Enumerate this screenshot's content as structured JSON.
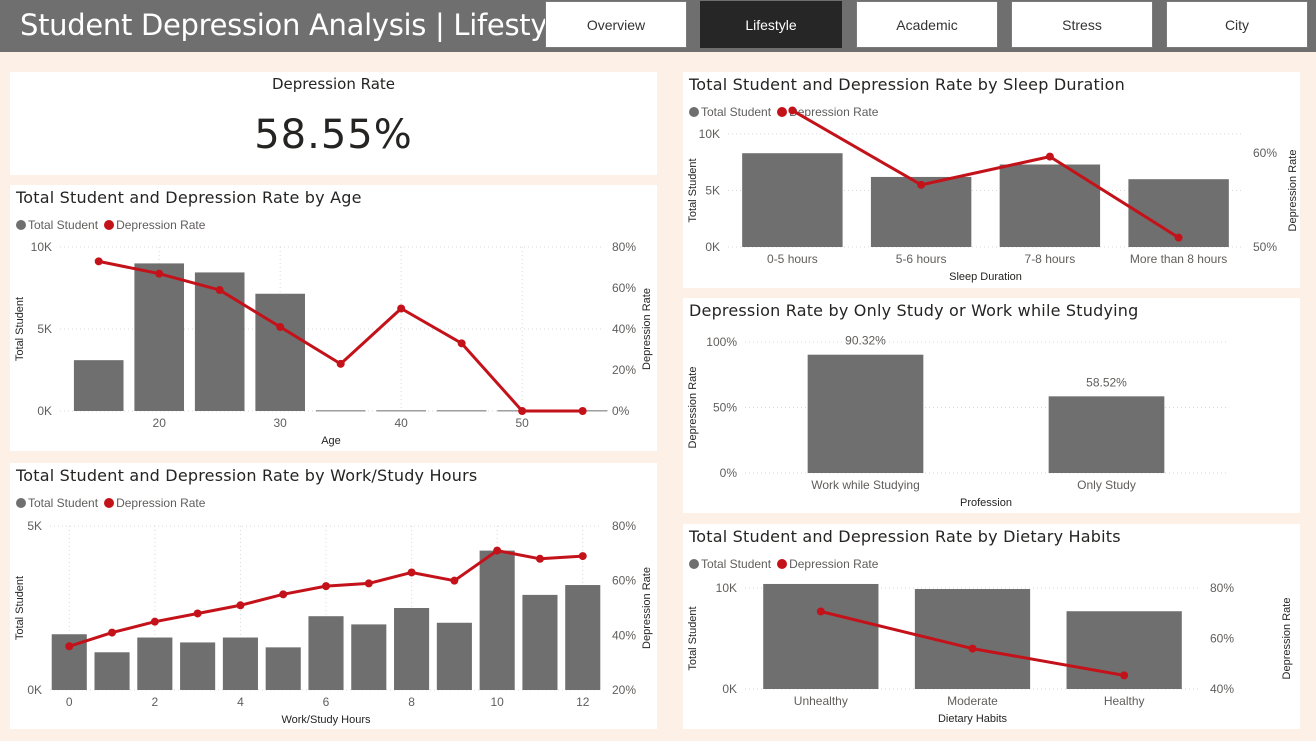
{
  "header": {
    "title": "Student Depression Analysis | Lifestyle",
    "tabs": [
      {
        "label": "Overview",
        "active": false
      },
      {
        "label": "Lifestyle",
        "active": true
      },
      {
        "label": "Academic",
        "active": false
      },
      {
        "label": "Stress",
        "active": false
      },
      {
        "label": "City",
        "active": false
      }
    ]
  },
  "colors": {
    "bar": "#6f6f6f",
    "line": "#c4121a",
    "grid": "#d9d9d9",
    "background": "#fdf0e6"
  },
  "kpi": {
    "title": "Depression Rate",
    "value": "58.55%"
  },
  "legend": {
    "total_student": "Total Student",
    "depression_rate": "Depression Rate"
  },
  "charts": {
    "age": {
      "title": "Total Student and Depression Rate by Age",
      "chart_data": {
        "type": "bar",
        "combo": "bar+line",
        "xlabel": "Age",
        "ylabel": "Total Student",
        "y2label": "Depression Rate",
        "x_ticks": [
          "20",
          "30",
          "40",
          "50"
        ],
        "x": [
          15,
          20,
          25,
          30,
          35,
          40,
          45,
          50,
          55
        ],
        "series": [
          {
            "name": "Total Student",
            "type": "bar",
            "values": [
              3100,
              9000,
              8450,
              7150,
              40,
              40,
              40,
              40,
              40
            ]
          },
          {
            "name": "Depression Rate",
            "type": "line",
            "axis": "right",
            "values": [
              73,
              67,
              59,
              41,
              23,
              50,
              33,
              0,
              0
            ]
          }
        ],
        "ylim": [
          0,
          10000
        ],
        "y_ticks": [
          "0K",
          "5K",
          "10K"
        ],
        "y2lim": [
          0,
          80
        ],
        "y2_ticks": [
          "0%",
          "20%",
          "40%",
          "60%",
          "80%"
        ]
      }
    },
    "sleep": {
      "title": "Total Student and Depression Rate by Sleep Duration",
      "chart_data": {
        "type": "bar",
        "combo": "bar+line",
        "xlabel": "Sleep Duration",
        "ylabel": "Total Student",
        "y2label": "Depression Rate",
        "categories": [
          "0-5 hours",
          "5-6 hours",
          "7-8 hours",
          "More than 8 hours"
        ],
        "series": [
          {
            "name": "Total Student",
            "type": "bar",
            "values": [
              8300,
              6200,
              7300,
              6000
            ]
          },
          {
            "name": "Depression Rate",
            "type": "line",
            "axis": "right",
            "values": [
              64.5,
              56.6,
              59.6,
              51.0
            ]
          }
        ],
        "ylim": [
          0,
          10000
        ],
        "y_ticks": [
          "0K",
          "5K",
          "10K"
        ],
        "y2lim": [
          50,
          62
        ],
        "y2_ticks": [
          "50%",
          "60%"
        ]
      }
    },
    "profession": {
      "title": "Depression Rate by Only Study or Work while Studying",
      "chart_data": {
        "type": "bar",
        "xlabel": "Profession",
        "ylabel": "Depression Rate",
        "categories": [
          "Work while Studying",
          "Only Study"
        ],
        "values": [
          90.32,
          58.52
        ],
        "data_labels": [
          "90.32%",
          "58.52%"
        ],
        "ylim": [
          0,
          100
        ],
        "y_ticks": [
          "0%",
          "50%",
          "100%"
        ]
      }
    },
    "hours": {
      "title": "Total Student and Depression Rate by Work/Study Hours",
      "chart_data": {
        "type": "bar",
        "combo": "bar+line",
        "xlabel": "Work/Study Hours",
        "ylabel": "Total Student",
        "y2label": "Depression Rate",
        "x_ticks": [
          "0",
          "2",
          "4",
          "6",
          "8",
          "10",
          "12"
        ],
        "x": [
          0,
          1,
          2,
          3,
          4,
          5,
          6,
          7,
          8,
          9,
          10,
          11,
          12
        ],
        "series": [
          {
            "name": "Total Student",
            "type": "bar",
            "values": [
              1700,
              1150,
              1600,
              1450,
              1600,
              1300,
              2250,
              2000,
              2500,
              2050,
              4250,
              2900,
              3200
            ]
          },
          {
            "name": "Depression Rate",
            "type": "line",
            "axis": "right",
            "values": [
              36,
              41,
              45,
              48,
              51,
              55,
              58,
              59,
              63,
              60,
              71,
              68,
              69
            ]
          }
        ],
        "ylim": [
          0,
          5000
        ],
        "y_ticks": [
          "0K",
          "5K"
        ],
        "y2lim": [
          20,
          80
        ],
        "y2_ticks": [
          "20%",
          "40%",
          "60%",
          "80%"
        ]
      }
    },
    "diet": {
      "title": "Total Student and Depression Rate by Dietary Habits",
      "chart_data": {
        "type": "bar",
        "combo": "bar+line",
        "xlabel": "Dietary Habits",
        "ylabel": "Total Student",
        "y2label": "Depression Rate",
        "categories": [
          "Unhealthy",
          "Moderate",
          "Healthy"
        ],
        "series": [
          {
            "name": "Total Student",
            "type": "bar",
            "values": [
              10400,
              9900,
              7700
            ]
          },
          {
            "name": "Depression Rate",
            "type": "line",
            "axis": "right",
            "values": [
              70.7,
              56.0,
              45.4
            ]
          }
        ],
        "ylim": [
          0,
          10000
        ],
        "y_ticks": [
          "0K",
          "10K"
        ],
        "y2lim": [
          40,
          80
        ],
        "y2_ticks": [
          "40%",
          "60%",
          "80%"
        ]
      }
    }
  }
}
